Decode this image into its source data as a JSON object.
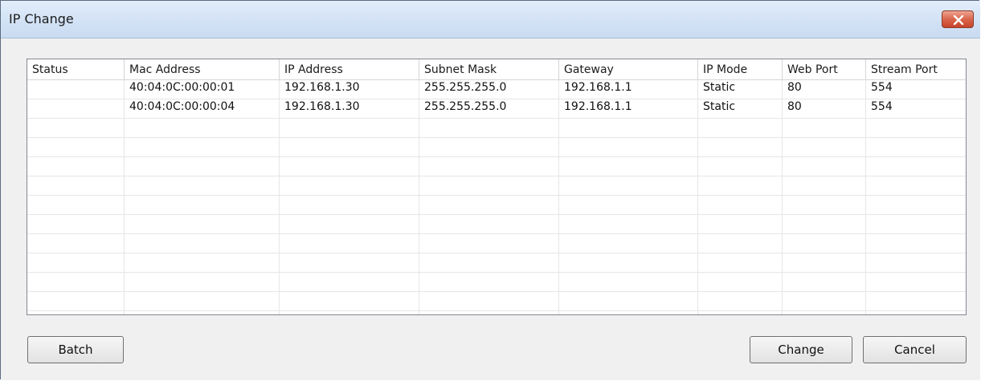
{
  "window": {
    "title": "IP Change"
  },
  "table": {
    "columns": [
      "Status",
      "Mac Address",
      "IP Address",
      "Subnet Mask",
      "Gateway",
      "IP Mode",
      "Web Port",
      "Stream Port"
    ],
    "rows": [
      [
        "",
        "40:04:0C:00:00:01",
        "192.168.1.30",
        "255.255.255.0",
        "192.168.1.1",
        "Static",
        "80",
        "554"
      ],
      [
        "",
        "40:04:0C:00:00:04",
        "192.168.1.30",
        "255.255.255.0",
        "192.168.1.1",
        "Static",
        "80",
        "554"
      ],
      [
        "",
        "",
        "",
        "",
        "",
        "",
        "",
        ""
      ],
      [
        "",
        "",
        "",
        "",
        "",
        "",
        "",
        ""
      ],
      [
        "",
        "",
        "",
        "",
        "",
        "",
        "",
        ""
      ],
      [
        "",
        "",
        "",
        "",
        "",
        "",
        "",
        ""
      ],
      [
        "",
        "",
        "",
        "",
        "",
        "",
        "",
        ""
      ],
      [
        "",
        "",
        "",
        "",
        "",
        "",
        "",
        ""
      ],
      [
        "",
        "",
        "",
        "",
        "",
        "",
        "",
        ""
      ],
      [
        "",
        "",
        "",
        "",
        "",
        "",
        "",
        ""
      ],
      [
        "",
        "",
        "",
        "",
        "",
        "",
        "",
        ""
      ],
      [
        "",
        "",
        "",
        "",
        "",
        "",
        "",
        ""
      ],
      [
        "",
        "",
        "",
        "",
        "",
        "",
        "",
        ""
      ]
    ]
  },
  "buttons": {
    "batch": "Batch",
    "change": "Change",
    "cancel": "Cancel"
  },
  "icons": {
    "close": "close-icon"
  },
  "colors": {
    "close_button": "#d9664c",
    "titlebar": "#d5e4f6"
  }
}
